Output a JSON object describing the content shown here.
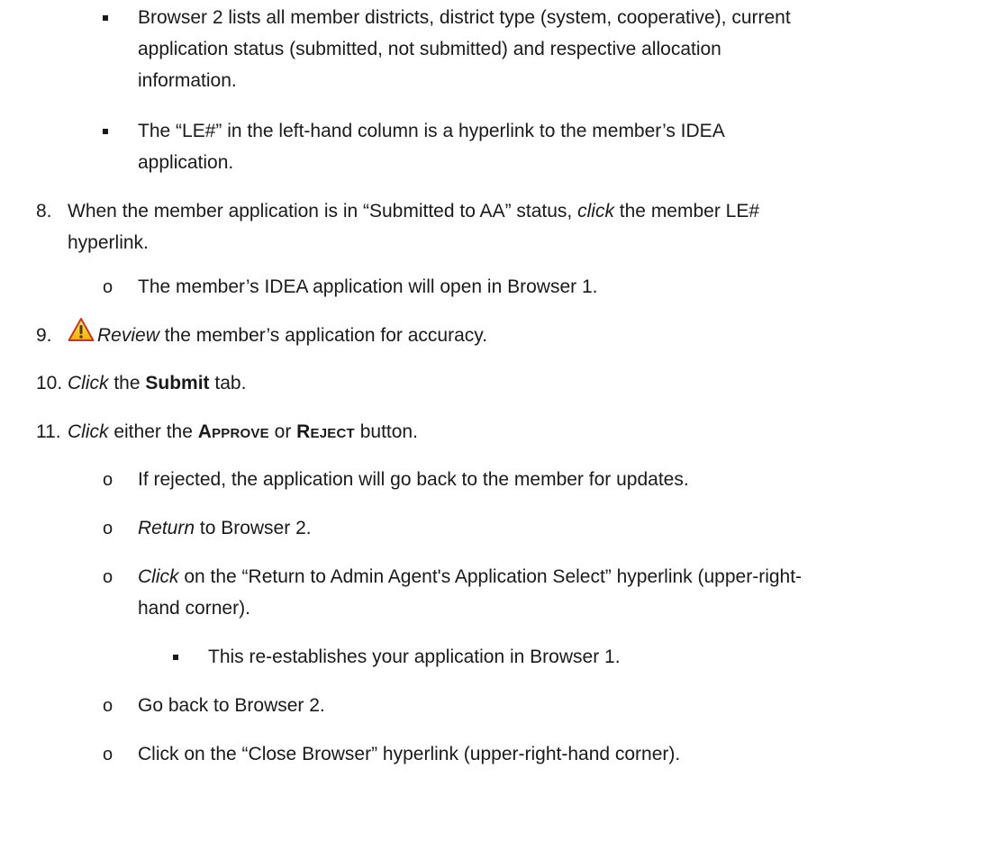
{
  "doc": {
    "b2": {
      "line1": "Browser 2 lists all member districts, district type (system, cooperative), current",
      "line2": "application status (submitted, not submitted) and respective allocation",
      "line3": "information."
    },
    "le": {
      "line1": "The “LE#” in the left-hand column is a hyperlink to the member’s IDEA",
      "line2": "application."
    },
    "step8": {
      "num": "8.",
      "pre": "When the member application is in “Submitted to AA” status, ",
      "click": "click",
      "post": " the member LE#",
      "line2": "hyperlink.",
      "sub": "The member’s IDEA application will open in Browser 1."
    },
    "step9": {
      "num": "9.",
      "review": "Review",
      "rest": " the member’s application for accuracy."
    },
    "step10": {
      "num": "10.",
      "click": "Click",
      "mid": " the ",
      "submit": "Submit",
      "end": " tab."
    },
    "step11": {
      "num": "11.",
      "click": "Click",
      "mid1": " either the ",
      "approve": "Approve",
      "mid2": " or ",
      "reject": "Reject",
      "end": " button.",
      "sub1": "If rejected, the application will go back to the member for updates.",
      "sub2_italic": "Return",
      "sub2_rest": " to Browser 2.",
      "sub3_italic": "Click",
      "sub3_rest": " on the “Return to Admin Agent's Application Select” hyperlink (upper-right-",
      "sub3_line2": "hand corner).",
      "sub3_bullet": "This re-establishes your application in Browser 1.",
      "sub4": "Go back to Browser 2.",
      "sub5": "Click on the “Close Browser” hyperlink (upper-right-hand corner)."
    },
    "bullet_o": "o"
  }
}
